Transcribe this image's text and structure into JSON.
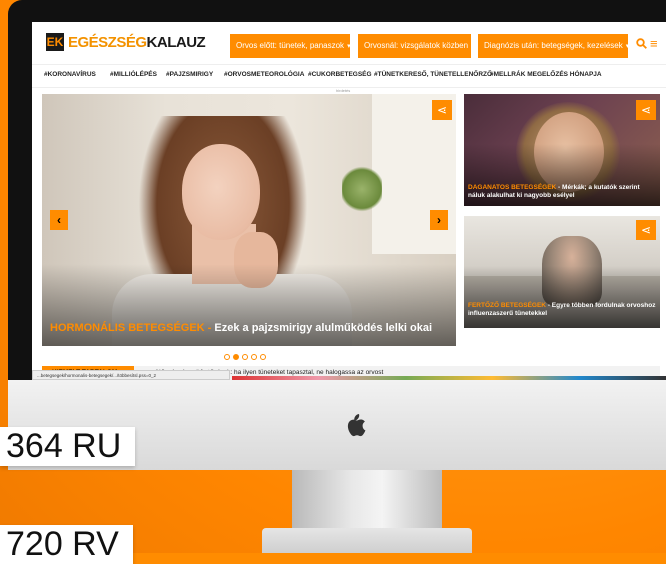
{
  "site": {
    "logo_mark": "EK",
    "logo_part1": "EGÉSZSÉG",
    "logo_part2": "KALAUZ"
  },
  "header": {
    "buttons": [
      {
        "label": "Orvos előtt: tünetek, panaszok"
      },
      {
        "label": "Orvosnál: vizsgálatok közben"
      },
      {
        "label": "Diagnózis után: betegségek, kezelések"
      }
    ]
  },
  "tags": [
    "#KORONAVÍRUS",
    "#MILLIÓLÉPÉS",
    "#PAJZSMIRIGY",
    "#ORVOSMETEOROLÓGIA",
    "#CUKORBETEGSÉG",
    "#TÜNETKERESŐ, TÜNETELLENŐRZŐ",
    "#MELLRÁK MEGELŐZÉS HÓNAPJA"
  ],
  "ad_label": "hirdetés",
  "hero": {
    "category": "HORMONÁLIS BETEGSÉGEK",
    "separator": " - ",
    "title": "Ezek a pajzsmirigy alulműködés lelki okai",
    "slides": 5,
    "active_slide": 2
  },
  "cards": [
    {
      "category": "DAGANATOS BETEGSÉGEK",
      "title": " - Mérkák; a kutatók szerint náluk alakulhat ki nagyobb esélyel"
    },
    {
      "category": "FERTŐZŐ BETEGSÉGEK",
      "title": " - Egyre többen fordulnak orvoshoz influenzaszerű tünetekkel"
    }
  ],
  "featured": {
    "label": "KIEMELT TARTALOM",
    "text": "Nőgyógyászati fertőzések: ha ilyen tüneteket tapasztal, ne halogassa az orvost"
  },
  "status_url": "...betegsegek/hormonalis-betegsegek/.../többesítsl.pss=0_2",
  "labels": [
    "364 RU",
    "720 RV"
  ],
  "colors": {
    "accent": "#ff8c00",
    "dark": "#1a1a1a"
  }
}
